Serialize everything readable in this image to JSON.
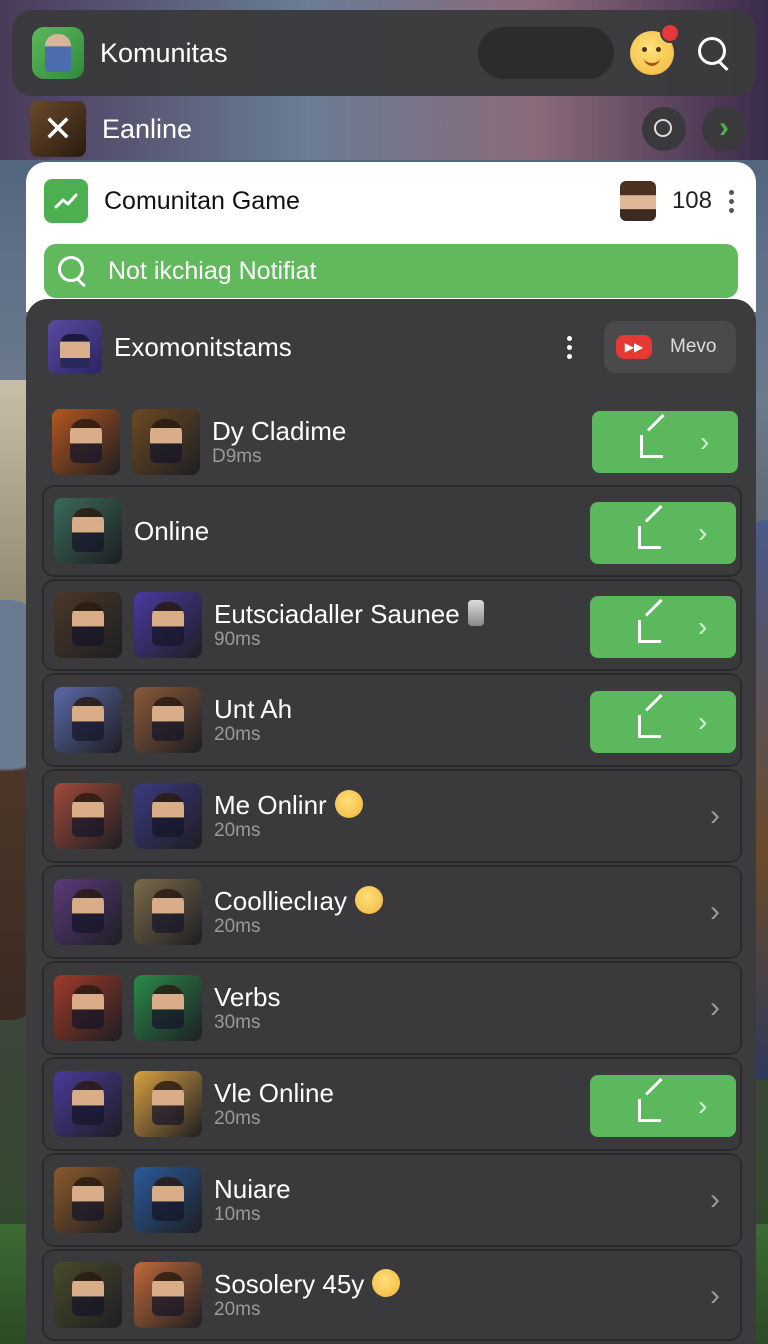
{
  "header": {
    "title": "Komunitas",
    "icons": [
      "app-icon",
      "emoji-notification-icon",
      "search-icon"
    ]
  },
  "subbar": {
    "title": "Eanline",
    "icons": [
      "close-icon",
      "ring-icon",
      "chevron-right-icon"
    ]
  },
  "card": {
    "title": "Comunitan Game",
    "count": "108",
    "notification_label": "Not ikchiag Notifiat"
  },
  "panel": {
    "title": "Exomonitstams",
    "mevo_label": "Mevo"
  },
  "items": [
    {
      "title": "Dy Cladime",
      "sub": "D9ms",
      "action": true,
      "thumbs": [
        "#b4571f",
        "#6b4a22"
      ]
    },
    {
      "title": "Online",
      "sub": "",
      "action": true,
      "thumbs": [
        "#3a6a5a"
      ]
    },
    {
      "title": "Eutsciadaller Saunee",
      "sub": "90ms",
      "action": true,
      "thumbs": [
        "#4a3828",
        "#4a3aa0"
      ],
      "lantern": true
    },
    {
      "title": "Unt Ah",
      "sub": "20ms",
      "action": true,
      "thumbs": [
        "#5a6aa8",
        "#8a5a3a"
      ]
    },
    {
      "title": "Me Onlinr",
      "sub": "20ms",
      "action": false,
      "thumbs": [
        "#a04a3a",
        "#3a3a80"
      ],
      "emoji": true
    },
    {
      "title": "Coollieclıay",
      "sub": "20ms",
      "action": false,
      "thumbs": [
        "#5a3a7a",
        "#7a6a4a"
      ],
      "emoji": true
    },
    {
      "title": "Verbs",
      "sub": "30ms",
      "action": false,
      "thumbs": [
        "#a03a2a",
        "#2a8a4a"
      ]
    },
    {
      "title": "Vle Online",
      "sub": "20ms",
      "action": true,
      "thumbs": [
        "#4a3a9a",
        "#d8a040"
      ]
    },
    {
      "title": "Nuiare",
      "sub": "10ms",
      "action": false,
      "thumbs": [
        "#8a5a2a",
        "#2a5a9a"
      ]
    },
    {
      "title": "Sosolery 45y",
      "sub": "20ms",
      "action": false,
      "thumbs": [
        "#4a4a2a",
        "#c06a3a"
      ],
      "emoji": true
    }
  ],
  "colors": {
    "accent_green": "#5cb85c",
    "panel_bg": "#3c3c3e",
    "badge_red": "#e53935"
  }
}
